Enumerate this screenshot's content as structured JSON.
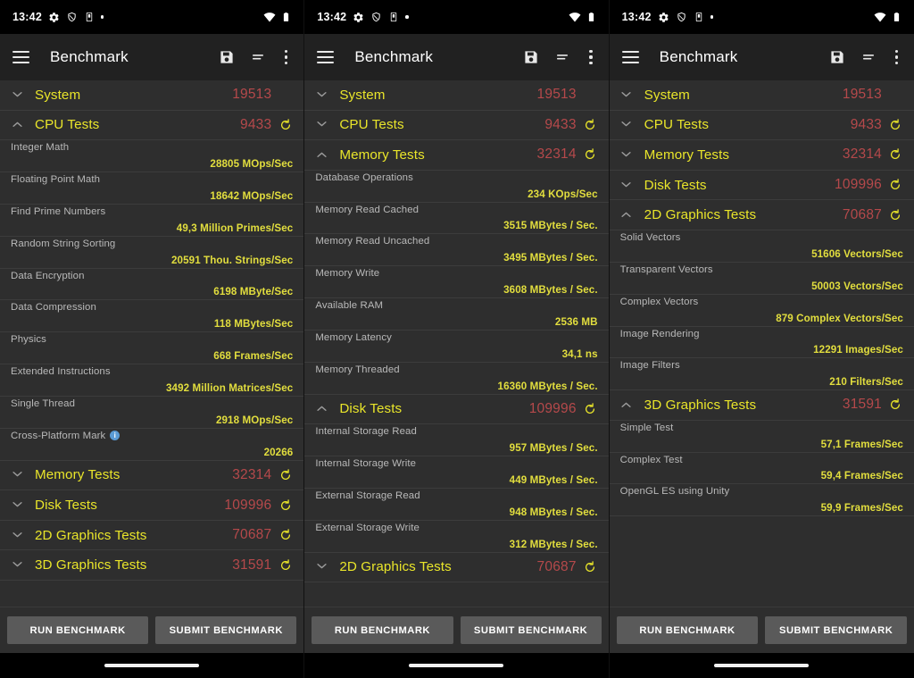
{
  "status_bar": {
    "time": "13:42",
    "left_icons": [
      "gear-icon",
      "shield-off-icon",
      "device-icon",
      "dot-icon"
    ],
    "right_icons": [
      "wifi-icon",
      "battery-icon"
    ]
  },
  "app_bar": {
    "title": "Benchmark",
    "menu_icon": "hamburger-icon",
    "actions": [
      "save-icon",
      "sort-icon",
      "overflow-icon"
    ]
  },
  "colors": {
    "group_label": "#e9e52a",
    "group_score": "#b5494b",
    "row_label": "#b9b9b9",
    "row_value": "#e2de3e",
    "app_bar_bg": "#212121",
    "list_bg": "#2e2e2e",
    "button_bg": "#5a5a5a",
    "info_badge": "#5b9bd5"
  },
  "buttons": {
    "run": "RUN BENCHMARK",
    "submit": "SUBMIT BENCHMARK"
  },
  "panels": [
    {
      "groups": [
        {
          "name": "System",
          "score": "19513",
          "expanded": false,
          "has_refresh": false,
          "rows": []
        },
        {
          "name": "CPU Tests",
          "score": "9433",
          "expanded": true,
          "has_refresh": true,
          "rows": [
            {
              "label": "Integer Math",
              "value": "28805 MOps/Sec"
            },
            {
              "label": "Floating Point Math",
              "value": "18642 MOps/Sec"
            },
            {
              "label": "Find Prime Numbers",
              "value": "49,3 Million Primes/Sec"
            },
            {
              "label": "Random String Sorting",
              "value": "20591 Thou. Strings/Sec"
            },
            {
              "label": "Data Encryption",
              "value": "6198 MByte/Sec"
            },
            {
              "label": "Data Compression",
              "value": "118 MBytes/Sec"
            },
            {
              "label": "Physics",
              "value": "668 Frames/Sec"
            },
            {
              "label": "Extended Instructions",
              "value": "3492 Million Matrices/Sec"
            },
            {
              "label": "Single Thread",
              "value": "2918 MOps/Sec"
            },
            {
              "label": "Cross-Platform Mark",
              "value": "20266",
              "info": true
            }
          ]
        },
        {
          "name": "Memory Tests",
          "score": "32314",
          "expanded": false,
          "has_refresh": true,
          "rows": []
        },
        {
          "name": "Disk Tests",
          "score": "109996",
          "expanded": false,
          "has_refresh": true,
          "rows": []
        },
        {
          "name": "2D Graphics Tests",
          "score": "70687",
          "expanded": false,
          "has_refresh": true,
          "rows": []
        },
        {
          "name": "3D Graphics Tests",
          "score": "31591",
          "expanded": false,
          "has_refresh": true,
          "rows": []
        }
      ],
      "button": "run"
    },
    {
      "groups": [
        {
          "name": "System",
          "score": "19513",
          "expanded": false,
          "has_refresh": false,
          "rows": []
        },
        {
          "name": "CPU Tests",
          "score": "9433",
          "expanded": false,
          "has_refresh": true,
          "rows": []
        },
        {
          "name": "Memory Tests",
          "score": "32314",
          "expanded": true,
          "has_refresh": true,
          "rows": [
            {
              "label": "Database Operations",
              "value": "234 KOps/Sec"
            },
            {
              "label": "Memory Read Cached",
              "value": "3515 MBytes / Sec."
            },
            {
              "label": "Memory Read Uncached",
              "value": "3495 MBytes / Sec."
            },
            {
              "label": "Memory Write",
              "value": "3608 MBytes / Sec."
            },
            {
              "label": "Available RAM",
              "value": "2536 MB"
            },
            {
              "label": "Memory Latency",
              "value": "34,1 ns"
            },
            {
              "label": "Memory Threaded",
              "value": "16360 MBytes / Sec."
            }
          ]
        },
        {
          "name": "Disk Tests",
          "score": "109996",
          "expanded": true,
          "has_refresh": true,
          "rows": [
            {
              "label": "Internal Storage Read",
              "value": "957 MBytes / Sec."
            },
            {
              "label": "Internal Storage Write",
              "value": "449 MBytes / Sec."
            },
            {
              "label": "External Storage Read",
              "value": "948 MBytes / Sec."
            },
            {
              "label": "External Storage Write",
              "value": "312 MBytes / Sec."
            }
          ]
        },
        {
          "name": "2D Graphics Tests",
          "score": "70687",
          "expanded": false,
          "has_refresh": true,
          "rows": []
        }
      ],
      "button": "submit_run"
    },
    {
      "groups": [
        {
          "name": "System",
          "score": "19513",
          "expanded": false,
          "has_refresh": false,
          "rows": []
        },
        {
          "name": "CPU Tests",
          "score": "9433",
          "expanded": false,
          "has_refresh": true,
          "rows": []
        },
        {
          "name": "Memory Tests",
          "score": "32314",
          "expanded": false,
          "has_refresh": true,
          "rows": []
        },
        {
          "name": "Disk Tests",
          "score": "109996",
          "expanded": false,
          "has_refresh": true,
          "rows": []
        },
        {
          "name": "2D Graphics Tests",
          "score": "70687",
          "expanded": true,
          "has_refresh": true,
          "rows": [
            {
              "label": "Solid Vectors",
              "value": "51606 Vectors/Sec"
            },
            {
              "label": "Transparent Vectors",
              "value": "50003 Vectors/Sec"
            },
            {
              "label": "Complex Vectors",
              "value": "879 Complex Vectors/Sec"
            },
            {
              "label": "Image Rendering",
              "value": "12291 Images/Sec"
            },
            {
              "label": "Image Filters",
              "value": "210 Filters/Sec"
            }
          ]
        },
        {
          "name": "3D Graphics Tests",
          "score": "31591",
          "expanded": true,
          "has_refresh": true,
          "rows": [
            {
              "label": "Simple Test",
              "value": "57,1 Frames/Sec"
            },
            {
              "label": "Complex Test",
              "value": "59,4 Frames/Sec"
            },
            {
              "label": "OpenGL ES using Unity",
              "value": "59,9 Frames/Sec"
            }
          ]
        }
      ],
      "button": "submit"
    }
  ]
}
